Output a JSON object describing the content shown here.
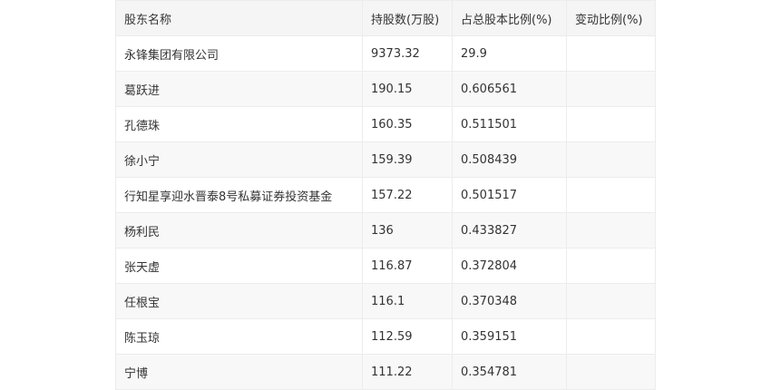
{
  "table": {
    "headers": [
      "股东名称",
      "持股数(万股)",
      "占总股本比例(%)",
      "变动比例(%)"
    ],
    "rows": [
      {
        "name": "永锋集团有限公司",
        "shares": "9373.32",
        "ratio": "29.9",
        "change": ""
      },
      {
        "name": "葛跃进",
        "shares": "190.15",
        "ratio": "0.606561",
        "change": ""
      },
      {
        "name": "孔德珠",
        "shares": "160.35",
        "ratio": "0.511501",
        "change": ""
      },
      {
        "name": "徐小宁",
        "shares": "159.39",
        "ratio": "0.508439",
        "change": ""
      },
      {
        "name": "行知星享迎水晋泰8号私募证券投资基金",
        "shares": "157.22",
        "ratio": "0.501517",
        "change": ""
      },
      {
        "name": "杨利民",
        "shares": "136",
        "ratio": "0.433827",
        "change": ""
      },
      {
        "name": "张天虚",
        "shares": "116.87",
        "ratio": "0.372804",
        "change": ""
      },
      {
        "name": "任根宝",
        "shares": "116.1",
        "ratio": "0.370348",
        "change": ""
      },
      {
        "name": "陈玉琼",
        "shares": "112.59",
        "ratio": "0.359151",
        "change": ""
      },
      {
        "name": "宁博",
        "shares": "111.22",
        "ratio": "0.354781",
        "change": ""
      }
    ]
  }
}
